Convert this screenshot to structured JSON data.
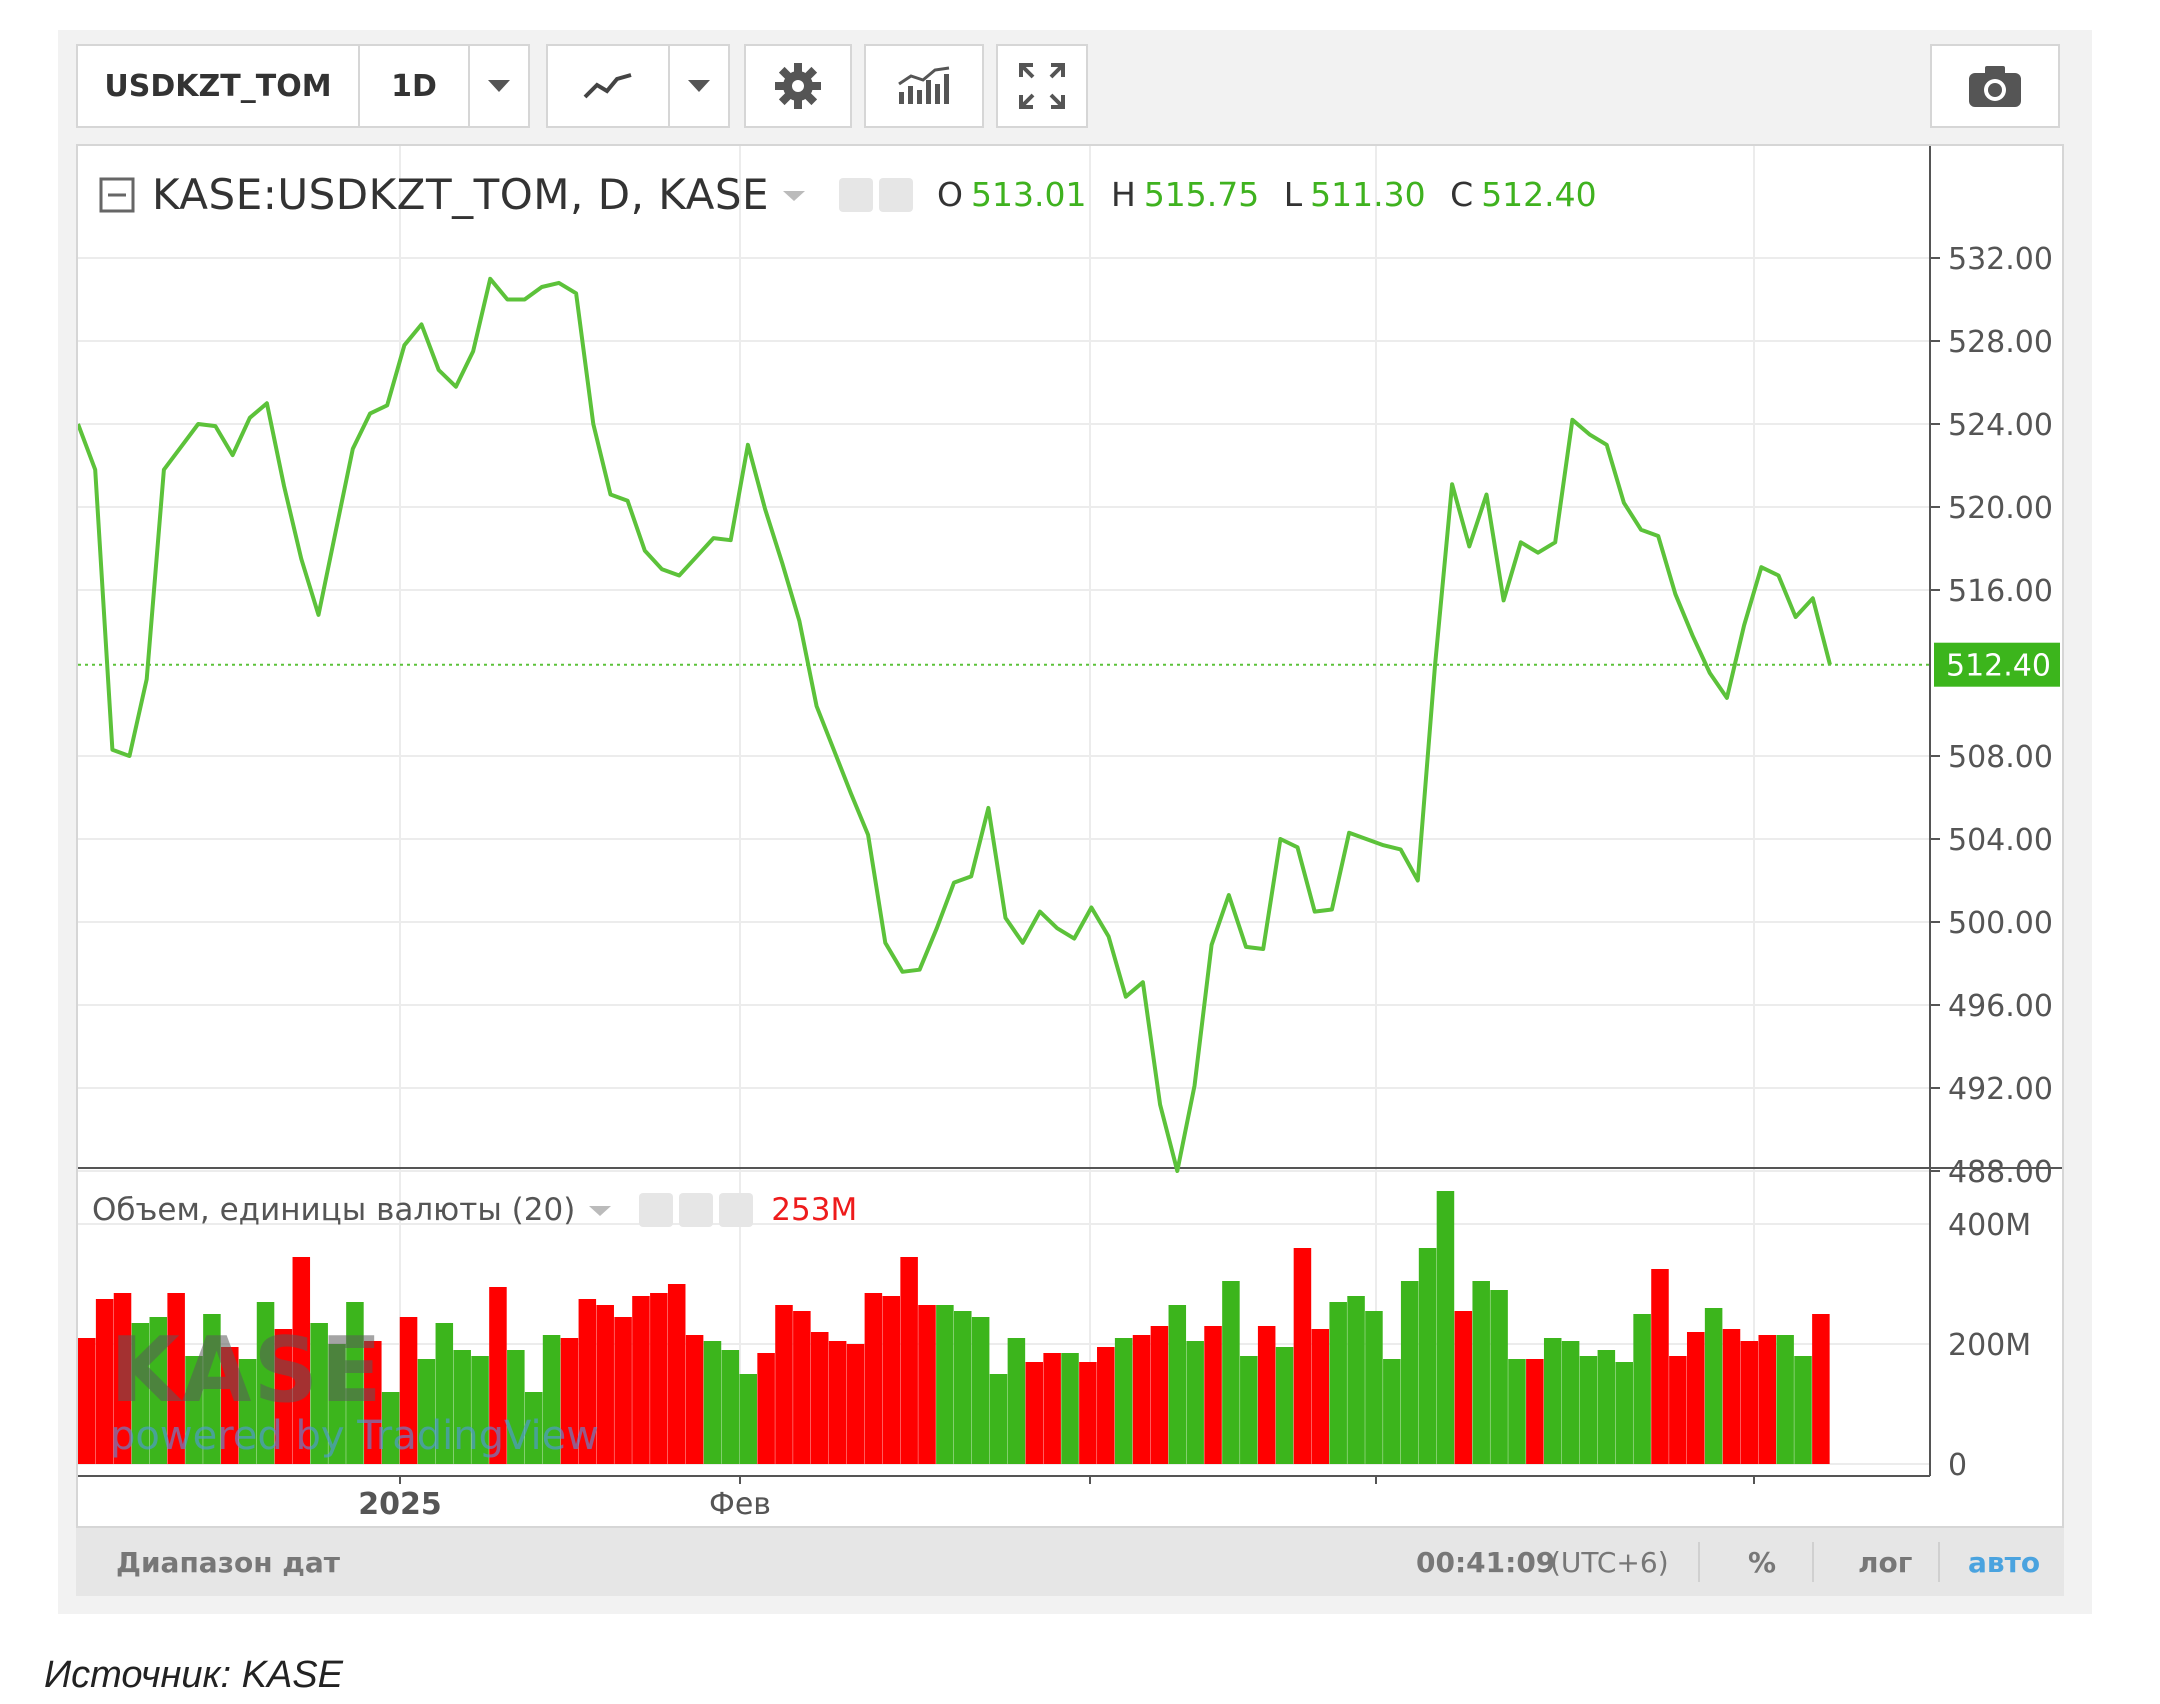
{
  "toolbar": {
    "symbol": "USDKZT_TOM",
    "interval": "1D"
  },
  "legend": {
    "title": "KASE:USDKZT_TOM, D, KASE",
    "o_label": "O",
    "o_value": "513.01",
    "h_label": "H",
    "h_value": "515.75",
    "l_label": "L",
    "l_value": "511.30",
    "c_label": "C",
    "c_value": "512.40"
  },
  "volume_legend": {
    "title": "Объем, единицы валюты (20)",
    "value": "253M"
  },
  "price_axis": {
    "ticks": [
      "532.00",
      "528.00",
      "524.00",
      "520.00",
      "516.00",
      "508.00",
      "504.00",
      "500.00",
      "496.00",
      "492.00",
      "488.00"
    ],
    "last_label": "512.40"
  },
  "volume_axis": {
    "ticks": [
      "400M",
      "200M",
      "0"
    ]
  },
  "time_axis": {
    "labels": [
      "2025",
      "Фев"
    ]
  },
  "bottom_bar": {
    "range": "Диапазон дат",
    "time": "00:41:09",
    "tz": "(UTC+6)",
    "percent": "%",
    "log": "лог",
    "auto": "авто"
  },
  "watermark": {
    "brand": "KASE",
    "powered": "powered by TradingView"
  },
  "caption": "Источник: KASE",
  "colors": {
    "up": "#3cb51c",
    "down": "#ff0000",
    "line": "#5cc23a",
    "accent": "#4aa3df"
  },
  "chart_data": {
    "type": "line",
    "price_ylim": [
      485,
      533
    ],
    "close": [
      524,
      521.8,
      508.3,
      508,
      511.7,
      521.8,
      522.9,
      524,
      523.9,
      522.5,
      524.3,
      525,
      521,
      517.5,
      514.8,
      518.8,
      522.8,
      524.5,
      524.9,
      527.8,
      528.8,
      526.6,
      525.8,
      527.5,
      531,
      530,
      530,
      530.6,
      530.8,
      530.3,
      524,
      520.6,
      520.3,
      517.9,
      517,
      516.7,
      517.6,
      518.5,
      518.4,
      523,
      519.9,
      517.3,
      514.5,
      510.4,
      508.3,
      506.2,
      504.2,
      499,
      497.6,
      497.7,
      499.7,
      501.9,
      502.2,
      505.5,
      500.2,
      499,
      500.5,
      499.7,
      499.2,
      500.7,
      499.3,
      496.4,
      497.1,
      491.2,
      488,
      492.1,
      498.9,
      501.3,
      498.8,
      498.7,
      504,
      503.6,
      500.5,
      500.6,
      504.3,
      504,
      503.7,
      503.5,
      502,
      512.3,
      521.1,
      518.1,
      520.6,
      515.5,
      518.3,
      517.8,
      518.3,
      524.2,
      523.5,
      523,
      520.2,
      518.9,
      518.6,
      515.8,
      513.8,
      512,
      510.8,
      514.3,
      517.1,
      516.7,
      514.7,
      515.6,
      512.4
    ],
    "volume_ylim": [
      0,
      460
    ],
    "volume": [
      210,
      275,
      285,
      235,
      245,
      285,
      180,
      250,
      195,
      175,
      270,
      225,
      345,
      235,
      200,
      270,
      205,
      120,
      245,
      175,
      235,
      190,
      180,
      295,
      190,
      120,
      215,
      210,
      275,
      265,
      245,
      280,
      285,
      300,
      215,
      205,
      190,
      150,
      185,
      265,
      255,
      220,
      205,
      200,
      285,
      280,
      345,
      265,
      265,
      255,
      245,
      150,
      210,
      170,
      185,
      185,
      170,
      195,
      210,
      215,
      230,
      265,
      205,
      230,
      305,
      180,
      230,
      195,
      360,
      225,
      270,
      280,
      255,
      175,
      305,
      360,
      455,
      255,
      305,
      290,
      175,
      175,
      210,
      205,
      180,
      190,
      170,
      250,
      325,
      180,
      220,
      260,
      225,
      205,
      215,
      215,
      180,
      250
    ],
    "volume_up": [
      0,
      0,
      0,
      1,
      1,
      0,
      1,
      1,
      0,
      1,
      1,
      0,
      0,
      1,
      1,
      1,
      0,
      1,
      0,
      1,
      1,
      1,
      1,
      0,
      1,
      1,
      1,
      0,
      0,
      0,
      0,
      0,
      0,
      0,
      0,
      1,
      1,
      1,
      0,
      0,
      0,
      0,
      0,
      0,
      0,
      0,
      0,
      0,
      1,
      1,
      1,
      1,
      1,
      0,
      0,
      1,
      0,
      0,
      1,
      0,
      0,
      1,
      1,
      0,
      1,
      1,
      0,
      1,
      0,
      0,
      1,
      1,
      1,
      1,
      1,
      1,
      1,
      0,
      1,
      1,
      1,
      0,
      1,
      1,
      1,
      1,
      1,
      1,
      0,
      0,
      0,
      1,
      0,
      0,
      0,
      1,
      1,
      0
    ]
  }
}
